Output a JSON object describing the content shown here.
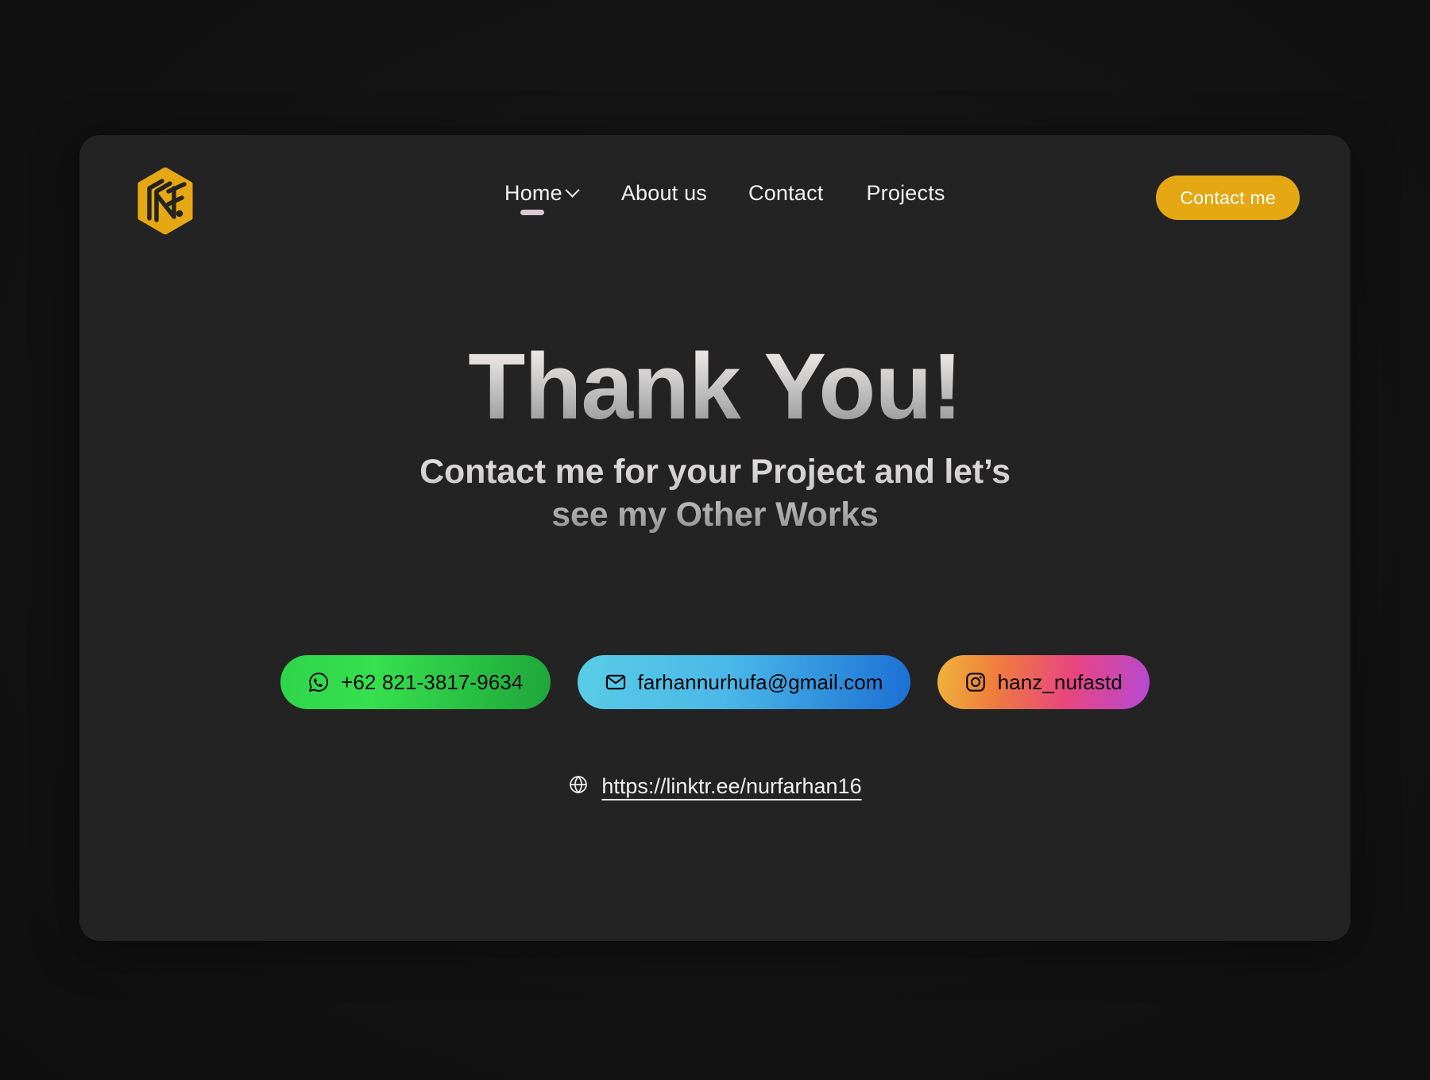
{
  "brand": {
    "logo_icon": "nf-hexagon-logo",
    "logo_color": "#E5A812"
  },
  "nav": {
    "items": [
      {
        "label": "Home",
        "active": true,
        "has_dropdown": true,
        "dropdown_icon": "chevron-down-icon"
      },
      {
        "label": "About us",
        "active": false,
        "has_dropdown": false
      },
      {
        "label": "Contact",
        "active": false,
        "has_dropdown": false
      },
      {
        "label": "Projects",
        "active": false,
        "has_dropdown": false
      }
    ],
    "active_indicator_color": "#DCC8D0"
  },
  "header": {
    "cta_label": "Contact me",
    "cta_color": "#E5A812"
  },
  "hero": {
    "title": "Thank You!",
    "subtitle_line1": "Contact me for your Project and let’s",
    "subtitle_line2": "see my Other Works"
  },
  "contacts": [
    {
      "id": "whatsapp",
      "icon": "whatsapp-icon",
      "label": "+62 821-3817-9634",
      "gradient_from": "#2ED44A",
      "gradient_to": "#1EA53A"
    },
    {
      "id": "email",
      "icon": "mail-icon",
      "label": "farhannurhufa@gmail.com",
      "gradient_from": "#59CDE6",
      "gradient_to": "#1B6FD4"
    },
    {
      "id": "instagram",
      "icon": "instagram-icon",
      "label": "hanz_nufastd",
      "gradient_from": "#EEB63C",
      "gradient_to": "#B44AD6"
    }
  ],
  "footer_link": {
    "icon": "globe-icon",
    "label": "https://linktr.ee/nurfarhan16"
  }
}
